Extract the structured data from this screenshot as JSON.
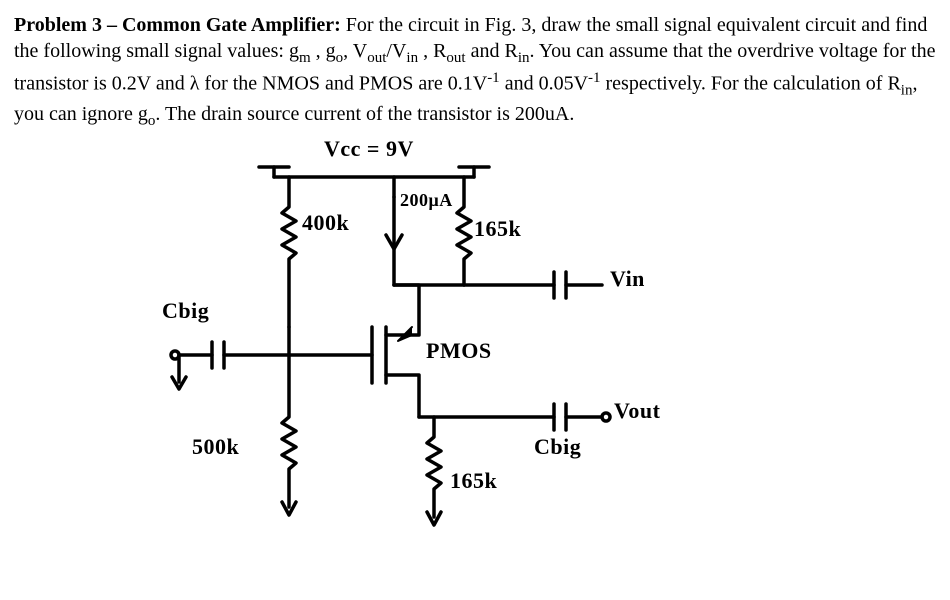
{
  "problem": {
    "heading": "Problem 3 – Common Gate Amplifier:",
    "body_1": " For the circuit in Fig. 3, draw the small signal equivalent circuit and find the following small signal values: g",
    "body_2": " , g",
    "body_3": ", V",
    "body_4": "/V",
    "body_5": " , R",
    "body_6": " and R",
    "body_7": ". You can assume that the overdrive voltage for the transistor is 0.2V and λ for the NMOS and PMOS are 0.1V",
    "body_8": " and 0.05V",
    "body_9": " respectively.  For the calculation of R",
    "body_10": ", you can ignore g",
    "body_11": ". The drain source current of the transistor is 200uA.",
    "sub_m": "m",
    "sub_o": "o",
    "sub_out": "out",
    "sub_in": "in",
    "sup_neg1": "-1"
  },
  "figure": {
    "vcc_label": "Vcc = 9V",
    "r1_label": "400k",
    "i_label": "200μA",
    "r2_label": "165k",
    "vin_label": "Vin",
    "cbig_left": "Cbig",
    "pmos_label": "PMOS",
    "vout_label": "Vout",
    "cbig_right": "Cbig",
    "r3_label": "500k",
    "r4_label": "165k"
  }
}
